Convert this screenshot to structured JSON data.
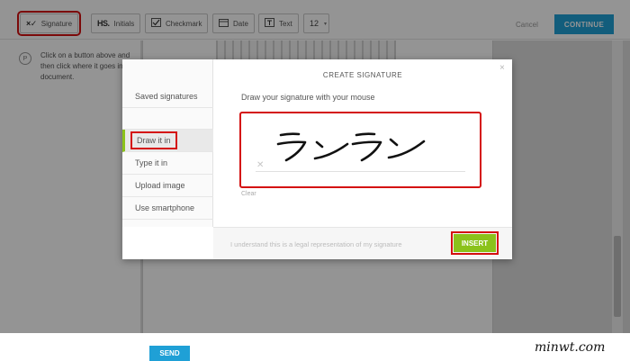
{
  "toolbar": {
    "signature_label": "Signature",
    "initials_label": "Initials",
    "initials_icon": "HS.",
    "checkmark_label": "Checkmark",
    "date_label": "Date",
    "text_label": "Text",
    "font_size": "12",
    "cancel_label": "Cancel",
    "continue_label": "CONTINUE"
  },
  "hint": {
    "icon_text": "P",
    "text": "Click on a button above and then click where it goes in the document."
  },
  "send_label": "SEND",
  "modal": {
    "title": "CREATE SIGNATURE",
    "close": "×",
    "instruction": "Draw your signature with your mouse",
    "clear_label": "Clear",
    "legal_text": "I understand this is a legal representation of my signature",
    "insert_label": "INSERT",
    "sidebar": [
      {
        "label": "Saved signatures"
      },
      {
        "label": ""
      },
      {
        "label": "Draw it in"
      },
      {
        "label": "Type it in"
      },
      {
        "label": "Upload image"
      },
      {
        "label": "Use smartphone"
      }
    ]
  },
  "watermark": "minwt.com",
  "colors": {
    "accent_blue": "#1fa0d6",
    "insert_green": "#8bc21b",
    "highlight_red": "#d41010"
  }
}
